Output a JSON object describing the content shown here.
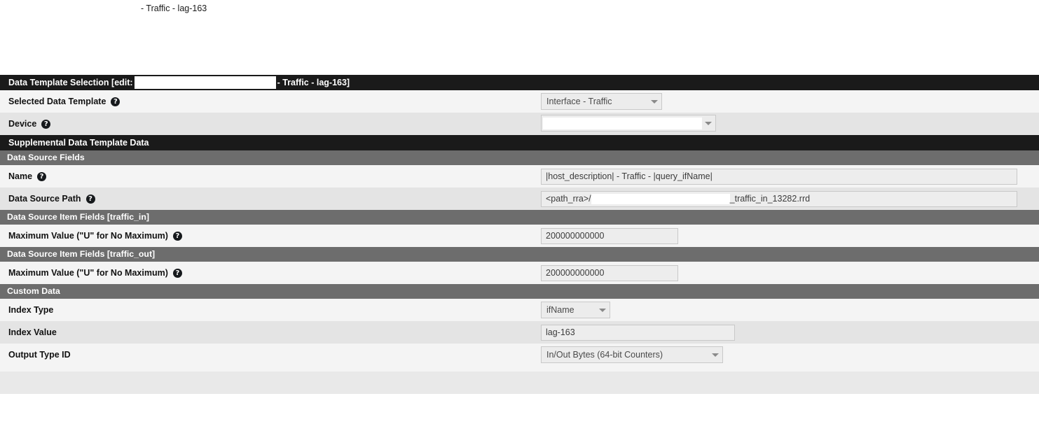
{
  "page": {
    "top_caption": "- Traffic - lag-163"
  },
  "title_bar": {
    "prefix": "Data Template Selection [edit:",
    "redacted": "",
    "suffix": "- Traffic - lag-163]"
  },
  "sections": {
    "supplemental": "Supplemental Data Template Data",
    "data_source_fields": "Data Source Fields",
    "item_fields_in": "Data Source Item Fields [traffic_in]",
    "item_fields_out": "Data Source Item Fields [traffic_out]",
    "custom_data": "Custom Data"
  },
  "fields": {
    "selected_data_template": {
      "label": "Selected Data Template",
      "help": "?",
      "value": "Interface - Traffic"
    },
    "device": {
      "label": "Device",
      "help": "?",
      "value": ""
    },
    "name": {
      "label": "Name",
      "help": "?",
      "value": "|host_description| - Traffic - |query_ifName|"
    },
    "data_source_path": {
      "label": "Data Source Path",
      "help": "?",
      "value_prefix": "<path_rra>/",
      "value_suffix": "_traffic_in_13282.rrd"
    },
    "max_value_in": {
      "label": "Maximum Value (\"U\" for No Maximum)",
      "help": "?",
      "value": "200000000000"
    },
    "max_value_out": {
      "label": "Maximum Value (\"U\" for No Maximum)",
      "help": "?",
      "value": "200000000000"
    },
    "index_type": {
      "label": "Index Type",
      "value": "ifName"
    },
    "index_value": {
      "label": "Index Value",
      "value": "lag-163"
    },
    "output_type_id": {
      "label": "Output Type ID",
      "value": "In/Out Bytes (64-bit Counters)"
    }
  },
  "colors": {
    "bar_black": "#1a1a1a",
    "bar_gray": "#6d6d6d",
    "row_light": "#f4f4f4",
    "row_dark": "#e4e4e4",
    "input_bg": "#ededed"
  }
}
